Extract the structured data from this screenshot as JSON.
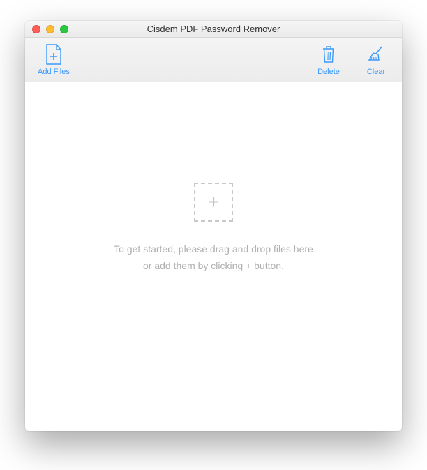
{
  "window": {
    "title": "Cisdem PDF Password Remover"
  },
  "toolbar": {
    "add_files_label": "Add Files",
    "delete_label": "Delete",
    "clear_label": "Clear"
  },
  "dropzone": {
    "plus": "+",
    "hint_line1": "To get started, please drag and drop files here",
    "hint_line2": "or add them by clicking + button."
  },
  "colors": {
    "accent": "#3b99fc"
  }
}
